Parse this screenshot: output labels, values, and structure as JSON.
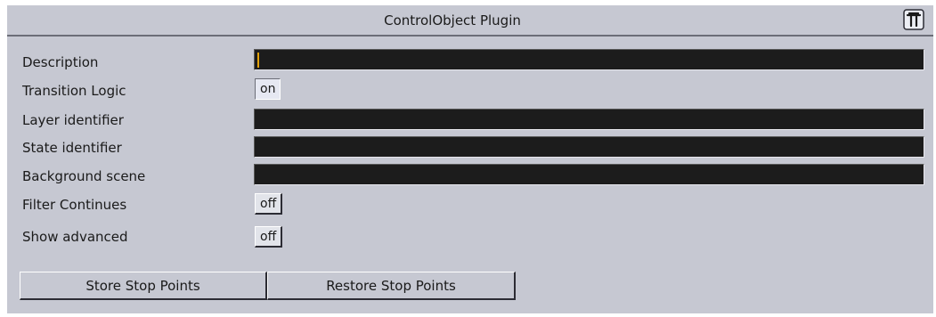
{
  "window": {
    "title": "ControlObject Plugin",
    "icon": "plugin-logo-icon"
  },
  "fields": {
    "description": {
      "label": "Description",
      "value": ""
    },
    "transition_logic": {
      "label": "Transition Logic",
      "value": "on"
    },
    "layer_identifier": {
      "label": "Layer identifier",
      "value": ""
    },
    "state_identifier": {
      "label": "State identifier",
      "value": ""
    },
    "background_scene": {
      "label": "Background scene",
      "value": ""
    },
    "filter_continues": {
      "label": "Filter Continues",
      "value": "off"
    },
    "show_advanced": {
      "label": "Show advanced",
      "value": "off"
    }
  },
  "buttons": {
    "store_stop_points": "Store Stop Points",
    "restore_stop_points": "Restore Stop Points"
  },
  "colors": {
    "panel_bg": "#c6c8d2",
    "field_bg": "#1c1c1c",
    "caret": "#e3a10a"
  }
}
